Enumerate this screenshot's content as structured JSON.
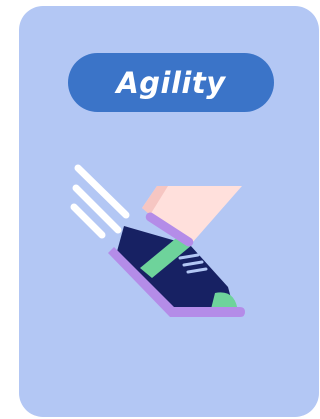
{
  "card": {
    "title": "Agility"
  },
  "icon": "running-shoe-icon",
  "colors": {
    "card_bg": "#b3c7f4",
    "pill_bg": "#3b74c8",
    "title_text": "#ffffff",
    "shoe_navy": "#172163",
    "shoe_green": "#6ed39b",
    "shoe_purple": "#b48ce8",
    "leg_pink": "#ffe0dc",
    "speed_lines": "#ffffff"
  }
}
